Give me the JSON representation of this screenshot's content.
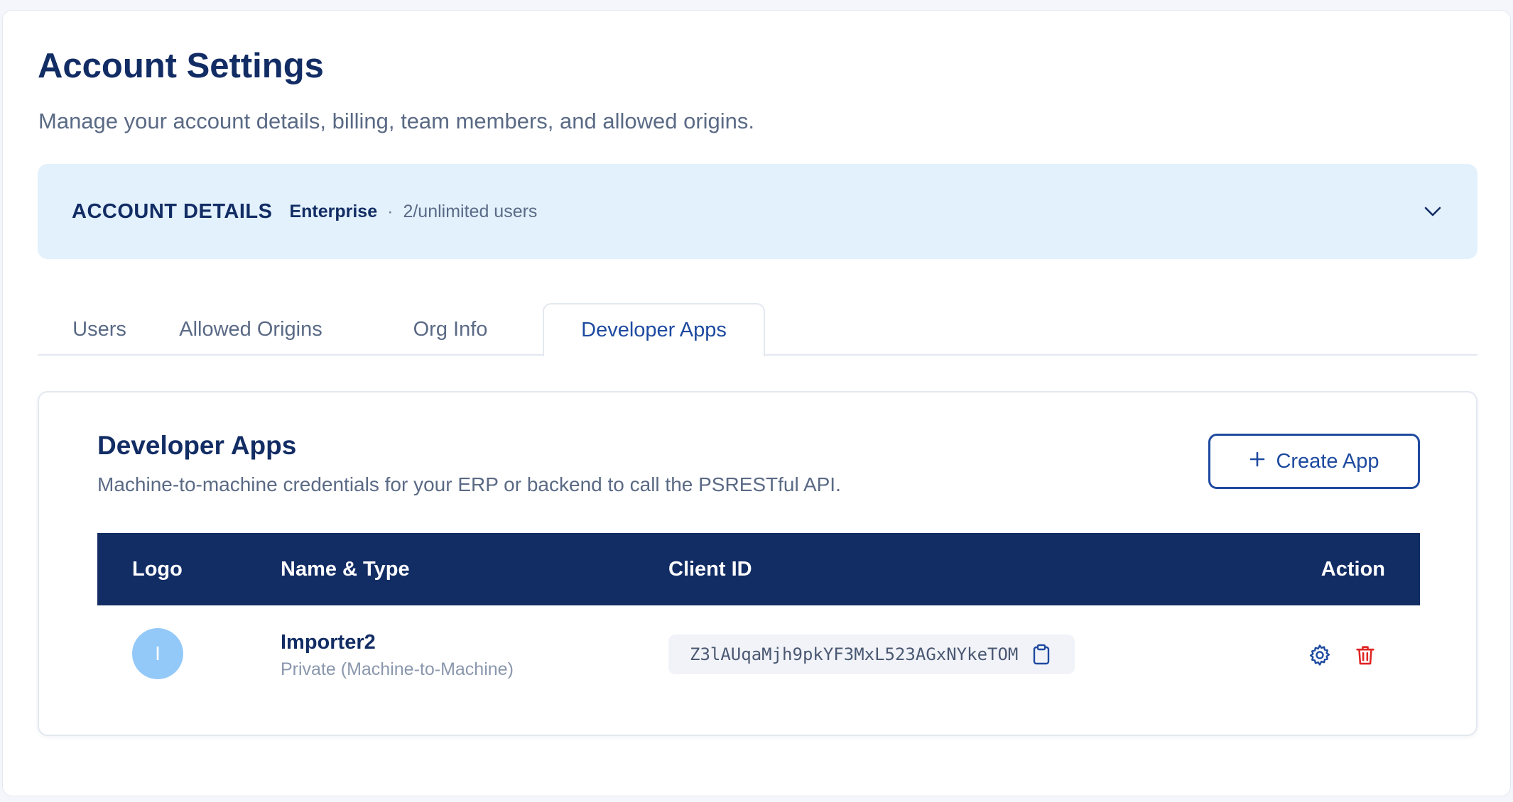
{
  "page": {
    "title": "Account Settings",
    "subtitle": "Manage your account details, billing, team members, and allowed origins."
  },
  "account_details": {
    "title": "ACCOUNT DETAILS",
    "plan": "Enterprise",
    "separator": "·",
    "users": "2/unlimited users",
    "toggle_icon": "chevron-down-icon"
  },
  "tabs": [
    {
      "label": "Users",
      "active": false
    },
    {
      "label": "Allowed Origins",
      "active": false
    },
    {
      "label": "Org Info",
      "active": false
    },
    {
      "label": "Developer Apps",
      "active": true
    }
  ],
  "developer_apps": {
    "title": "Developer Apps",
    "description": "Machine-to-machine credentials for your ERP or backend to call the PSRESTful API.",
    "create_button": {
      "icon": "plus-icon",
      "label": "Create App"
    },
    "table": {
      "columns": [
        "Logo",
        "Name & Type",
        "Client ID",
        "Action"
      ],
      "rows": [
        {
          "logo_initial": "I",
          "name": "Importer2",
          "type": "Private (Machine-to-Machine)",
          "client_id": "Z3lAUqaMjh9pkYF3MxL523AGxNYkeTOM",
          "copy_icon": "clipboard-icon",
          "actions": [
            "gear-icon",
            "trash-icon"
          ]
        }
      ]
    }
  },
  "colors": {
    "primary_navy": "#122c64",
    "accent_blue": "#1e4aa0",
    "panel_bg": "#e2f1fc",
    "avatar_bg": "#93c9f8",
    "danger_red": "#e02424"
  }
}
